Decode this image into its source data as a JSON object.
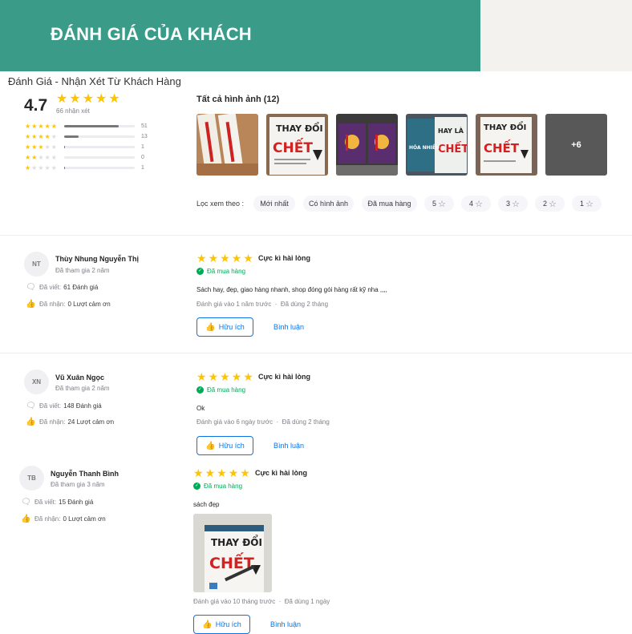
{
  "banner": {
    "title": "ĐÁNH GIÁ CỦA KHÁCH"
  },
  "section": {
    "heading": "Đánh Giá - Nhận Xét Từ Khách Hàng"
  },
  "summary": {
    "average": "4.7",
    "total_label": "66 nhận xét",
    "distribution": [
      {
        "stars": 5,
        "count": "51",
        "fraction": 0.77
      },
      {
        "stars": 4,
        "count": "13",
        "fraction": 0.2
      },
      {
        "stars": 3,
        "count": "1",
        "fraction": 0.015
      },
      {
        "stars": 2,
        "count": "0",
        "fraction": 0
      },
      {
        "stars": 1,
        "count": "1",
        "fraction": 0.015
      }
    ]
  },
  "gallery": {
    "title": "Tất cả hình ảnh (12)",
    "more_label": "+6",
    "cover_texts": [
      "THAY ĐỔI",
      "CHẾT",
      "HAY LÀ",
      "HÓA NHIỀU"
    ]
  },
  "filters": {
    "label": "Lọc xem theo :",
    "chips": [
      "Mới nhất",
      "Có hình ảnh",
      "Đã mua hàng",
      "5",
      "4",
      "3",
      "2",
      "1"
    ]
  },
  "reviews": [
    {
      "initials": "NT",
      "name": "Thùy Nhung Nguyễn Thị",
      "joined": "Đã tham gia 2 năm",
      "written_label": "Đã viết:",
      "written_value": "61 Đánh giá",
      "thanks_label": "Đã nhận:",
      "thanks_value": "0 Lượt cảm ơn",
      "rating": 5,
      "title": "Cực kì hài lòng",
      "bought": "Đã mua hàng",
      "text": "Sách hay, đẹp, giao hàng nhanh, shop đóng gói hàng rất kỹ nha ,,,,",
      "date": "Đánh giá vào 1 năm trước",
      "used": "Đã dùng 2 tháng",
      "useful_label": "Hữu ích",
      "comment_label": "Bình luận"
    },
    {
      "initials": "XN",
      "name": "Vũ Xuân Ngọc",
      "joined": "Đã tham gia 2 năm",
      "written_label": "Đã viết:",
      "written_value": "148 Đánh giá",
      "thanks_label": "Đã nhận:",
      "thanks_value": "24 Lượt cảm ơn",
      "rating": 5,
      "title": "Cực kì hài lòng",
      "bought": "Đã mua hàng",
      "text": "Ok",
      "date": "Đánh giá vào 6 ngày trước",
      "used": "Đã dùng 2 tháng",
      "useful_label": "Hữu ích",
      "comment_label": "Bình luận"
    },
    {
      "initials": "TB",
      "name": "Nguyễn Thanh Bình",
      "joined": "Đã tham gia 3 năm",
      "written_label": "Đã viết:",
      "written_value": "15 Đánh giá",
      "thanks_label": "Đã nhận:",
      "thanks_value": "0 Lượt cảm ơn",
      "rating": 5,
      "title": "Cực kì hài lòng",
      "bought": "Đã mua hàng",
      "text": "sách đẹp",
      "date": "Đánh giá vào 10 tháng trước",
      "used": "Đã dùng 1 ngày",
      "useful_label": "Hữu ích",
      "comment_label": "Bình luận"
    }
  ],
  "colors": {
    "accent": "#3a9b88",
    "star": "#ffc400",
    "link": "#0b74e5",
    "green": "#00ab56"
  }
}
